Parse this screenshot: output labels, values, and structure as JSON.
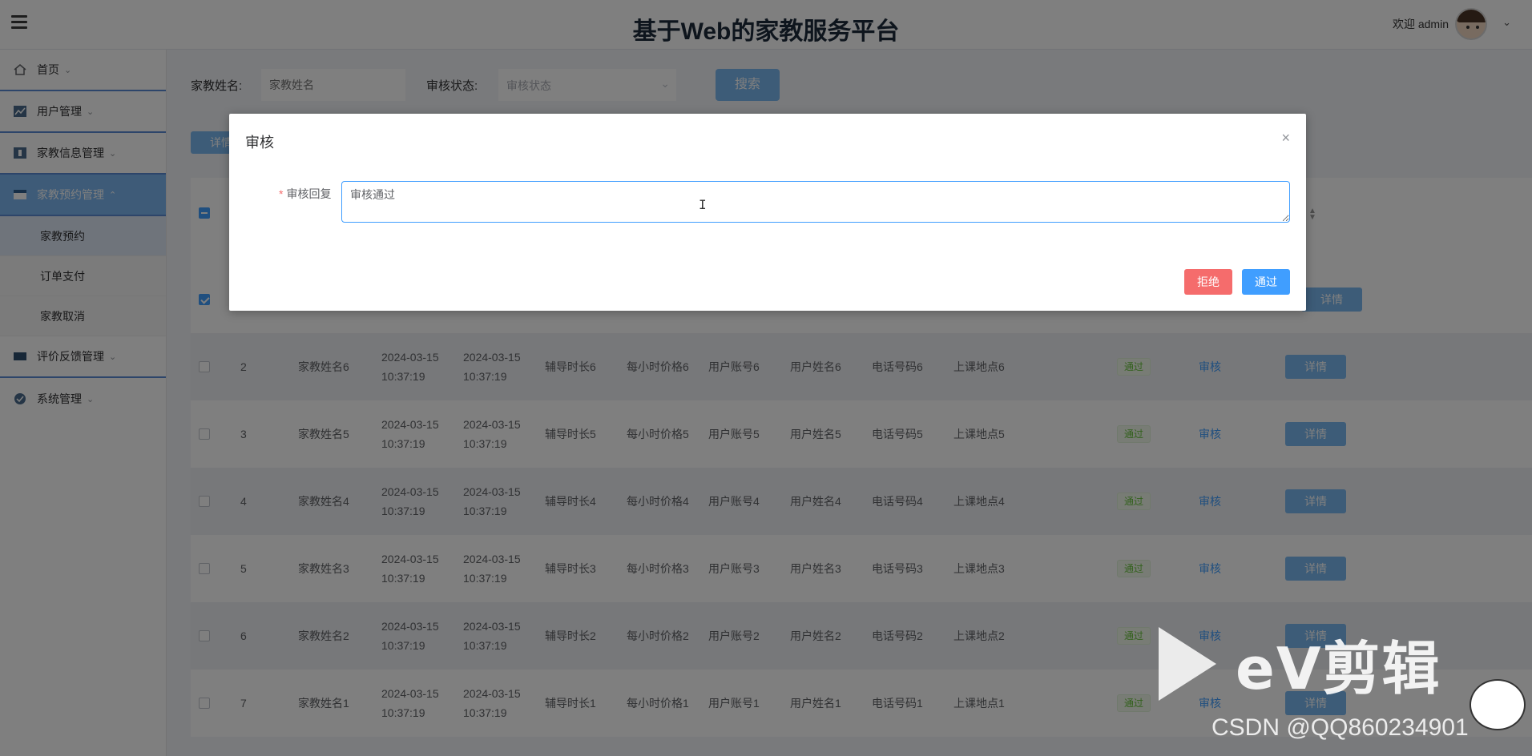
{
  "header": {
    "title": "基于Web的家教服务平台",
    "welcome": "欢迎 admin",
    "chevron": "⌄"
  },
  "sidebar": {
    "items": [
      {
        "label": "首页",
        "icon": "home-icon"
      },
      {
        "label": "用户管理",
        "icon": "user-icon"
      },
      {
        "label": "家教信息管理",
        "icon": "info-icon"
      },
      {
        "label": "家教预约管理",
        "icon": "appointment-icon"
      },
      {
        "label": "评价反馈管理",
        "icon": "feedback-icon"
      },
      {
        "label": "系统管理",
        "icon": "system-icon"
      }
    ],
    "sub_items": [
      "家教预约",
      "订单支付",
      "家教取消"
    ]
  },
  "search": {
    "name_label": "家教姓名:",
    "name_placeholder": "家教姓名",
    "status_label": "审核状态:",
    "status_placeholder": "审核状态",
    "search_button": "搜索",
    "detail_button": "详情"
  },
  "table": {
    "rows": [
      {
        "no": "2",
        "name": "家教姓名6",
        "date1": "2024-03-15",
        "time1": "10:37:19",
        "date2": "2024-03-15",
        "time2": "10:37:19",
        "duration": "辅导时长6",
        "price": "每小时价格6",
        "account": "用户账号6",
        "username": "用户姓名6",
        "phone": "电话号码6",
        "place": "上课地点6",
        "status": "通过",
        "review": "审核",
        "detail": "详情"
      },
      {
        "no": "3",
        "name": "家教姓名5",
        "date1": "2024-03-15",
        "time1": "10:37:19",
        "date2": "2024-03-15",
        "time2": "10:37:19",
        "duration": "辅导时长5",
        "price": "每小时价格5",
        "account": "用户账号5",
        "username": "用户姓名5",
        "phone": "电话号码5",
        "place": "上课地点5",
        "status": "通过",
        "review": "审核",
        "detail": "详情"
      },
      {
        "no": "4",
        "name": "家教姓名4",
        "date1": "2024-03-15",
        "time1": "10:37:19",
        "date2": "2024-03-15",
        "time2": "10:37:19",
        "duration": "辅导时长4",
        "price": "每小时价格4",
        "account": "用户账号4",
        "username": "用户姓名4",
        "phone": "电话号码4",
        "place": "上课地点4",
        "status": "通过",
        "review": "审核",
        "detail": "详情"
      },
      {
        "no": "5",
        "name": "家教姓名3",
        "date1": "2024-03-15",
        "time1": "10:37:19",
        "date2": "2024-03-15",
        "time2": "10:37:19",
        "duration": "辅导时长3",
        "price": "每小时价格3",
        "account": "用户账号3",
        "username": "用户姓名3",
        "phone": "电话号码3",
        "place": "上课地点3",
        "status": "通过",
        "review": "审核",
        "detail": "详情"
      },
      {
        "no": "6",
        "name": "家教姓名2",
        "date1": "2024-03-15",
        "time1": "10:37:19",
        "date2": "2024-03-15",
        "time2": "10:37:19",
        "duration": "辅导时长2",
        "price": "每小时价格2",
        "account": "用户账号2",
        "username": "用户姓名2",
        "phone": "电话号码2",
        "place": "上课地点2",
        "status": "通过",
        "review": "审核",
        "detail": "详情"
      },
      {
        "no": "7",
        "name": "家教姓名1",
        "date1": "2024-03-15",
        "time1": "10:37:19",
        "date2": "2024-03-15",
        "time2": "10:37:19",
        "duration": "辅导时长1",
        "price": "每小时价格1",
        "account": "用户账号1",
        "username": "用户姓名1",
        "phone": "电话号码1",
        "place": "上课地点1",
        "status": "通过",
        "review": "审核",
        "detail": "详情"
      }
    ],
    "first_row_detail": "详情"
  },
  "dialog": {
    "title": "审核",
    "close": "×",
    "reply_label": "审核回复",
    "required_mark": "*",
    "reply_value": "审核通过",
    "reject_button": "拒绝",
    "pass_button": "通过"
  },
  "watermark": {
    "ev_text": "eV剪辑",
    "csdn_text": "CSDN @QQ860234901"
  }
}
